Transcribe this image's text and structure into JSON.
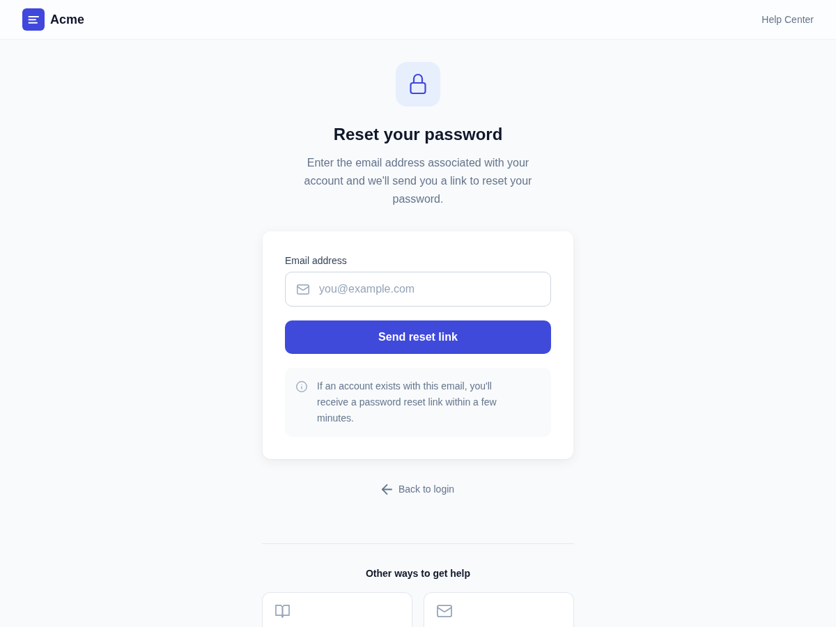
{
  "header": {
    "brand": "Acme",
    "help_link": "Help Center"
  },
  "hero": {
    "title": "Reset your password",
    "subtitle": "Enter the email address associated with your account and we'll send you a link to reset your password."
  },
  "form": {
    "email_label": "Email address",
    "email_field": {
      "placeholder": "you@example.com"
    },
    "submit_button": "Send reset link",
    "notice": "If an account exists with this email, you'll receive a password reset link within a few minutes."
  },
  "back_link": "Back to login",
  "help": {
    "title": "Other ways to get help",
    "options": [
      {
        "kind": "docs"
      },
      {
        "kind": "email"
      }
    ]
  }
}
